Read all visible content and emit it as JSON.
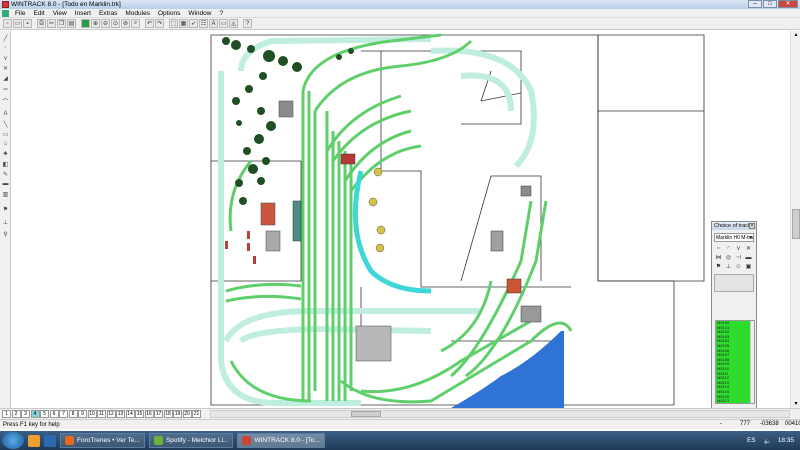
{
  "window": {
    "title": "WINTRACK 8.0 - [Todo en Marklin.trk]"
  },
  "menu": [
    "File",
    "Edit",
    "View",
    "Insert",
    "Extras",
    "Modules",
    "Options",
    "Window",
    "?"
  ],
  "status": {
    "help": "Press F1 key for help",
    "dash": "-",
    "value1": "777",
    "value2": "-03638",
    "value3": "00410"
  },
  "track_panel": {
    "title": "Choice of track",
    "selected": "Marklin H0 M-tra",
    "items": [
      "M5100",
      "M5101",
      "M5102",
      "M5103",
      "M5104",
      "M5105",
      "M5106",
      "M5107",
      "M5108",
      "M5109",
      "M5110",
      "M5111",
      "M5112",
      "M5113",
      "M5114",
      "M5115",
      "M5120",
      "M5121",
      "M5122",
      "M5123",
      "M5125",
      "M5128",
      "M5129",
      "M5130",
      "M5131",
      "M5135",
      "M5137",
      "M5138",
      "M5139",
      "M5140"
    ]
  },
  "taskbar": {
    "tasks": [
      {
        "label": "ForoTrenes • Ver Te..."
      },
      {
        "label": "Spotify - Melchior Li..."
      },
      {
        "label": "WINTRACK 8.0 - [To..."
      }
    ],
    "lang": "ES",
    "time": "18:35"
  },
  "layers": [
    "1",
    "2",
    "3",
    "4",
    "5",
    "6",
    "7",
    "8",
    "9",
    "10",
    "11",
    "12",
    "13",
    "14",
    "15",
    "16",
    "17",
    "18",
    "19",
    "20",
    "21"
  ],
  "colors": {
    "track_green": "#5fcf6b",
    "track_light": "#bfeee0",
    "water": "#2f73d6",
    "trees": "#1f4f22",
    "panel_green": "#2ddc2d"
  }
}
